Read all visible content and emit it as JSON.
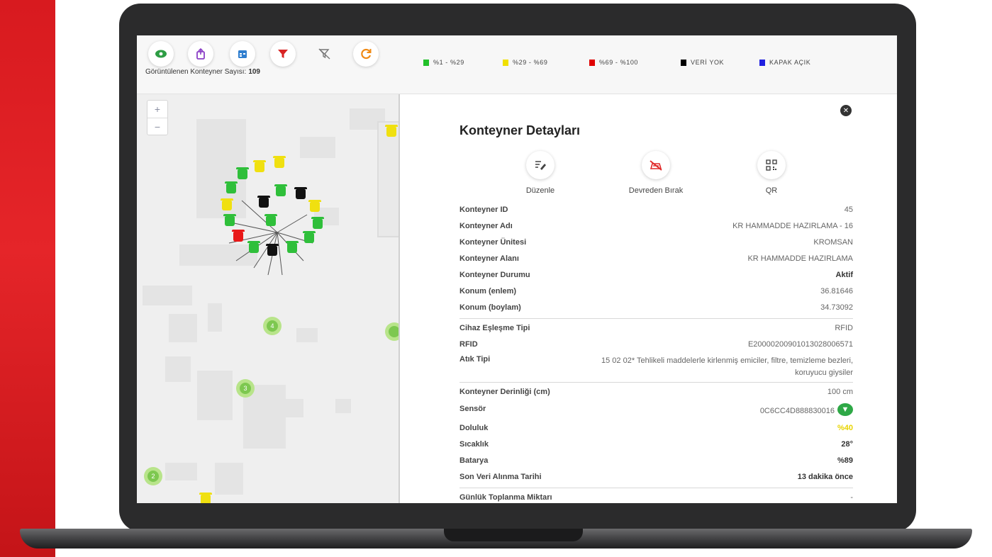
{
  "toolbar": {
    "buttons": [
      {
        "icon": "eye-icon",
        "color": "#2e9d44"
      },
      {
        "icon": "trash-upload-icon",
        "color": "#8b3fc6"
      },
      {
        "icon": "calendar-icon",
        "color": "#2f7ecf"
      },
      {
        "icon": "filter-icon",
        "color": "#d82424"
      },
      {
        "icon": "filter-clear-icon",
        "color": "#777777"
      },
      {
        "icon": "refresh-icon",
        "color": "#f08a14"
      }
    ],
    "count_label": "Görüntülenen Konteyner Sayısı:",
    "count_value": "109"
  },
  "legend": [
    {
      "label": "%1 - %29",
      "color": "#22c02a"
    },
    {
      "label": "%29 - %69",
      "color": "#f0e000"
    },
    {
      "label": "%69 - %100",
      "color": "#e00000"
    },
    {
      "label": "VERİ YOK",
      "color": "#000000"
    },
    {
      "label": "KAPAK AÇIK",
      "color": "#2020e0"
    }
  ],
  "map": {
    "zoom_in": "+",
    "zoom_out": "−",
    "clusters": [
      "4",
      "3",
      "2"
    ]
  },
  "details": {
    "title": "Konteyner Detayları",
    "close": "✕",
    "actions": [
      {
        "label": "Düzenle",
        "icon": "edit-icon"
      },
      {
        "label": "Devreden Bırak",
        "icon": "deactivate-icon"
      },
      {
        "label": "QR",
        "icon": "qr-icon"
      }
    ],
    "rows": [
      {
        "k": "Konteyner ID",
        "v": "45"
      },
      {
        "k": "Konteyner Adı",
        "v": "KR HAMMADDE HAZIRLAMA - 16"
      },
      {
        "k": "Konteyner Ünitesi",
        "v": "KROMSAN"
      },
      {
        "k": "Konteyner Alanı",
        "v": "KR HAMMADDE HAZIRLAMA"
      },
      {
        "k": "Konteyner Durumu",
        "v": "Aktif"
      },
      {
        "k": "Konum (enlem)",
        "v": "36.81646"
      },
      {
        "k": "Konum (boylam)",
        "v": "34.73092"
      },
      {
        "k": "Cihaz Eşleşme Tipi",
        "v": "RFID"
      },
      {
        "k": "RFID",
        "v": "E20000200901013028006571"
      },
      {
        "k": "Atık Tipi",
        "v": "15 02 02* Tehlikeli maddelerle kirlenmiş emiciler, filtre, temizleme bezleri, koruyucu giysiler"
      },
      {
        "k": "Konteyner Derinliği (cm)",
        "v": "100 cm"
      },
      {
        "k": "Sensör",
        "v": "0C6CC4D888830016"
      },
      {
        "k": "Doluluk",
        "v": "%40"
      },
      {
        "k": "Sıcaklık",
        "v": "28°"
      },
      {
        "k": "Batarya",
        "v": "%89"
      },
      {
        "k": "Son Veri Alınma Tarihi",
        "v": "13 dakika önce"
      },
      {
        "k": "Günlük Toplanma Miktarı",
        "v": "-"
      }
    ],
    "doluluk_color": "#e8d400"
  }
}
